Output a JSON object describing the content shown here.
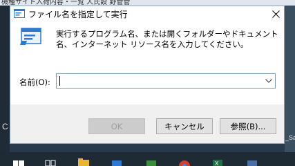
{
  "background": {
    "top_text": "機種サイト入荷内容・一覧 人氏設 野管管",
    "left_char": "C",
    "right_text": "_Sa"
  },
  "dialog": {
    "title": "ファイル名を指定して実行",
    "description": "実行するプログラム名、または開くフォルダーやドキュメント名、インターネット リソース名を入力してください。",
    "open_label": "名前(O):",
    "open_value": "",
    "buttons": {
      "ok": "OK",
      "cancel": "キャンセル",
      "browse": "参照(B)..."
    }
  },
  "taskbar": {
    "icons": [
      "start-icon",
      "task-view-icon",
      "file-explorer-icon",
      "store-icon",
      "app-icon",
      "chrome-icon",
      "excel-icon",
      "app2-icon"
    ]
  },
  "colors": {
    "accent": "#2b79d4",
    "dialog_border": "#8aa3b8",
    "footer_bg": "#f0f0f0",
    "button_bg": "#e1e1e1"
  }
}
